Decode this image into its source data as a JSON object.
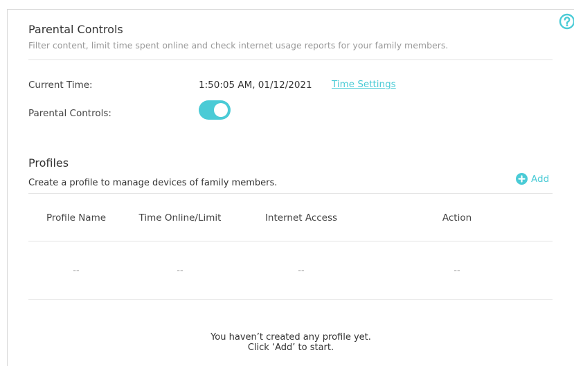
{
  "header": {
    "title": "Parental Controls",
    "description": "Filter content, limit time spent online and check internet usage reports for your family members."
  },
  "settings": {
    "current_time_label": "Current Time:",
    "current_time_value": "1:50:05 AM, 01/12/2021",
    "time_settings_link": "Time Settings",
    "parental_controls_label": "Parental Controls:",
    "parental_controls_enabled": true
  },
  "profiles": {
    "title": "Profiles",
    "description": "Create a profile to manage devices of family members.",
    "add_label": "Add",
    "columns": [
      "Profile Name",
      "Time Online/Limit",
      "Internet Access",
      "Action"
    ],
    "row": [
      "--",
      "--",
      "--",
      "--"
    ],
    "empty_line1": "You haven’t created any profile yet.",
    "empty_line2": "Click ‘Add’ to start."
  },
  "icons": {
    "help": "help-circle-icon",
    "add": "plus-circle-icon"
  },
  "colors": {
    "accent": "#4acbd6",
    "muted_text": "#999999"
  }
}
